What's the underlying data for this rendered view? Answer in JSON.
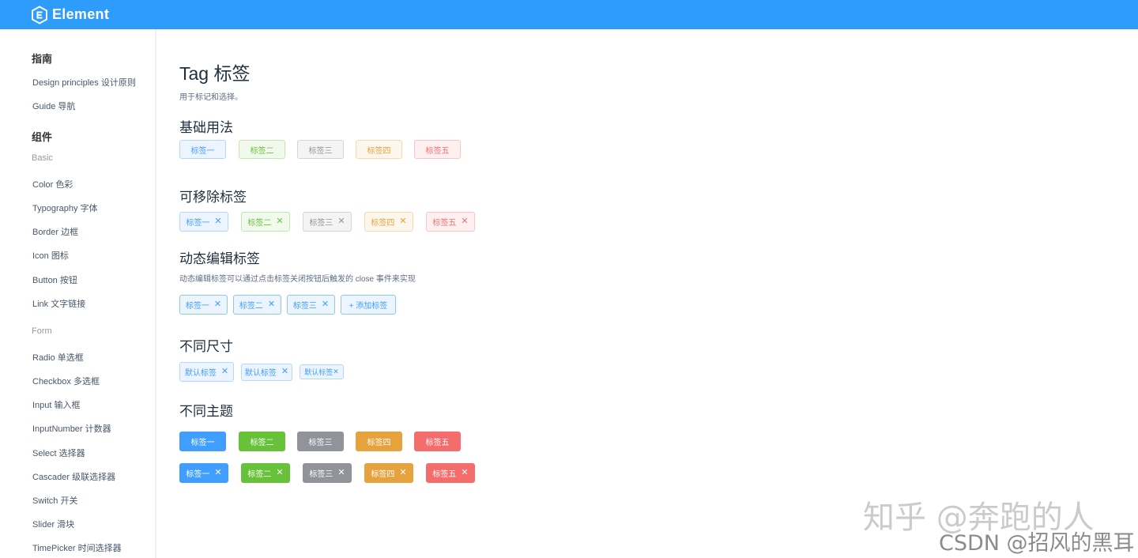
{
  "header": {
    "brand": "Element"
  },
  "sidebar": {
    "groups": {
      "guide": "指南",
      "components": "组件"
    },
    "guide_items": [
      "Design principles 设计原则",
      "Guide 导航"
    ],
    "basic_label": "Basic",
    "basic_items": [
      "Color 色彩",
      "Typography 字体",
      "Border 边框",
      "Icon 图标",
      "Button 按钮",
      "Link 文字链接"
    ],
    "form_label": "Form",
    "form_items": [
      "Radio 单选框",
      "Checkbox 多选框",
      "Input 输入框",
      "InputNumber 计数器",
      "Select 选择器",
      "Cascader 级联选择器",
      "Switch 开关",
      "Slider 滑块",
      "TimePicker 时间选择器"
    ]
  },
  "page": {
    "title": "Tag 标签",
    "desc": "用于标记和选择。"
  },
  "sections": {
    "basic": {
      "title": "基础用法",
      "tags": [
        "标签一",
        "标签二",
        "标签三",
        "标签四",
        "标签五"
      ]
    },
    "closable": {
      "title": "可移除标签",
      "tags": [
        "标签一",
        "标签二",
        "标签三",
        "标签四",
        "标签五"
      ]
    },
    "dynamic": {
      "title": "动态编辑标签",
      "desc": "动态编辑标签可以通过点击标签关闭按钮后触发的 close 事件来实现",
      "tags": [
        "标签一",
        "标签二",
        "标签三"
      ],
      "add_button": "+ 添加标签"
    },
    "sizes": {
      "title": "不同尺寸",
      "tags": [
        "默认标签",
        "默认标签",
        "默认标签"
      ]
    },
    "themes": {
      "title": "不同主题",
      "dark_tags": [
        "标签一",
        "标签二",
        "标签三",
        "标签四",
        "标签五"
      ],
      "dark_closable_tags": [
        "标签一",
        "标签二",
        "标签三",
        "标签四",
        "标签五"
      ]
    }
  },
  "close_glyph": "✕",
  "colors": {
    "primary": "#409eff",
    "success": "#67c23a",
    "info": "#909399",
    "warning": "#e6a23c",
    "danger": "#f56c6c",
    "header": "#2d9cfb"
  },
  "watermarks": {
    "zhihu": "知乎 @奔跑的人",
    "csdn": "CSDN @招风的黑耳"
  }
}
